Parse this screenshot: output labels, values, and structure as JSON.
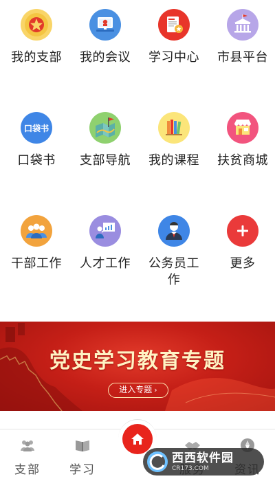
{
  "menu": {
    "row1": [
      {
        "label": "我的支部",
        "icon": "party-emblem-icon"
      },
      {
        "label": "我的会议",
        "icon": "meeting-icon"
      },
      {
        "label": "学习中心",
        "icon": "study-document-icon"
      },
      {
        "label": "市县平台",
        "icon": "government-building-icon"
      }
    ],
    "row2": [
      {
        "label": "口袋书",
        "icon": "pocket-book-icon",
        "icon_text": "口袋书"
      },
      {
        "label": "支部导航",
        "icon": "map-flag-icon"
      },
      {
        "label": "我的课程",
        "icon": "bookshelf-icon"
      },
      {
        "label": "扶贫商城",
        "icon": "shop-stall-icon"
      }
    ],
    "row3": [
      {
        "label": "干部工作",
        "icon": "group-people-icon"
      },
      {
        "label": "人才工作",
        "icon": "presentation-icon"
      },
      {
        "label": "公务员工作",
        "icon": "official-person-icon"
      },
      {
        "label": "更多",
        "icon": "plus-icon"
      }
    ]
  },
  "banner": {
    "title": "党史学习教育专题",
    "button_label": "进入专题",
    "button_chevron": "›"
  },
  "tabbar": {
    "tabs": [
      {
        "label": "支部",
        "icon": "people-icon"
      },
      {
        "label": "学习",
        "icon": "open-book-icon"
      },
      {
        "label": "",
        "icon": "home-icon"
      },
      {
        "label": "服务",
        "icon": "handshake-icon"
      },
      {
        "label": "资讯",
        "icon": "compass-icon"
      }
    ]
  },
  "watermark": {
    "main": "西西软件园",
    "sub": "CR173.COM"
  },
  "colors": {
    "accent_red": "#e8241c",
    "banner_red": "#c51f17",
    "tab_gray": "#555555"
  }
}
